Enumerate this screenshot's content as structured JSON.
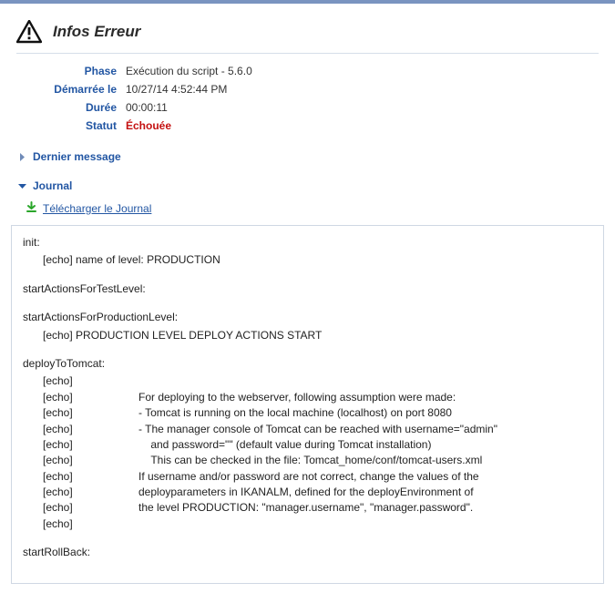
{
  "header": {
    "title": "Infos Erreur"
  },
  "info": {
    "phase_label": "Phase",
    "phase_value": "Exécution du script - 5.6.0",
    "started_label": "Démarrée le",
    "started_value": "10/27/14 4:52:44 PM",
    "duration_label": "Durée",
    "duration_value": "00:00:11",
    "status_label": "Statut",
    "status_value": "Échouée"
  },
  "sections": {
    "last_message": "Dernier message",
    "journal": "Journal"
  },
  "download": {
    "label": "Télécharger le Journal"
  },
  "log": {
    "blocks": [
      {
        "target": "init:",
        "lines": [
          {
            "indent": 1,
            "text": "[echo] name of level: PRODUCTION"
          }
        ]
      },
      {
        "target": "startActionsForTestLevel:",
        "lines": []
      },
      {
        "target": "startActionsForProductionLevel:",
        "lines": [
          {
            "indent": 1,
            "text": "[echo] PRODUCTION LEVEL DEPLOY ACTIONS START"
          }
        ]
      },
      {
        "target": "deployToTomcat:",
        "lines": [
          {
            "indent": 1,
            "label": "[echo]",
            "text": ""
          },
          {
            "indent": 1,
            "label": "[echo]",
            "text": "For deploying to the webserver, following assumption were made:"
          },
          {
            "indent": 1,
            "label": "[echo]",
            "text": "- Tomcat is running on the local machine (localhost) on port 8080"
          },
          {
            "indent": 1,
            "label": "[echo]",
            "text": "- The manager console of Tomcat can be reached with username=\"admin\""
          },
          {
            "indent": 1,
            "label": "[echo]",
            "text": "    and password=\"\" (default value during Tomcat installation)"
          },
          {
            "indent": 1,
            "label": "[echo]",
            "text": "    This can be checked in the file: Tomcat_home/conf/tomcat-users.xml"
          },
          {
            "indent": 1,
            "label": "[echo]",
            "text": "If username and/or password are not correct, change the values of the"
          },
          {
            "indent": 1,
            "label": "[echo]",
            "text": "deployparameters in IKANALM, defined for the deployEnvironment of"
          },
          {
            "indent": 1,
            "label": "[echo]",
            "text": "the level PRODUCTION:  \"manager.username\", \"manager.password\"."
          },
          {
            "indent": 1,
            "label": "[echo]",
            "text": ""
          }
        ]
      },
      {
        "target": "startRollBack:",
        "lines": []
      }
    ]
  }
}
